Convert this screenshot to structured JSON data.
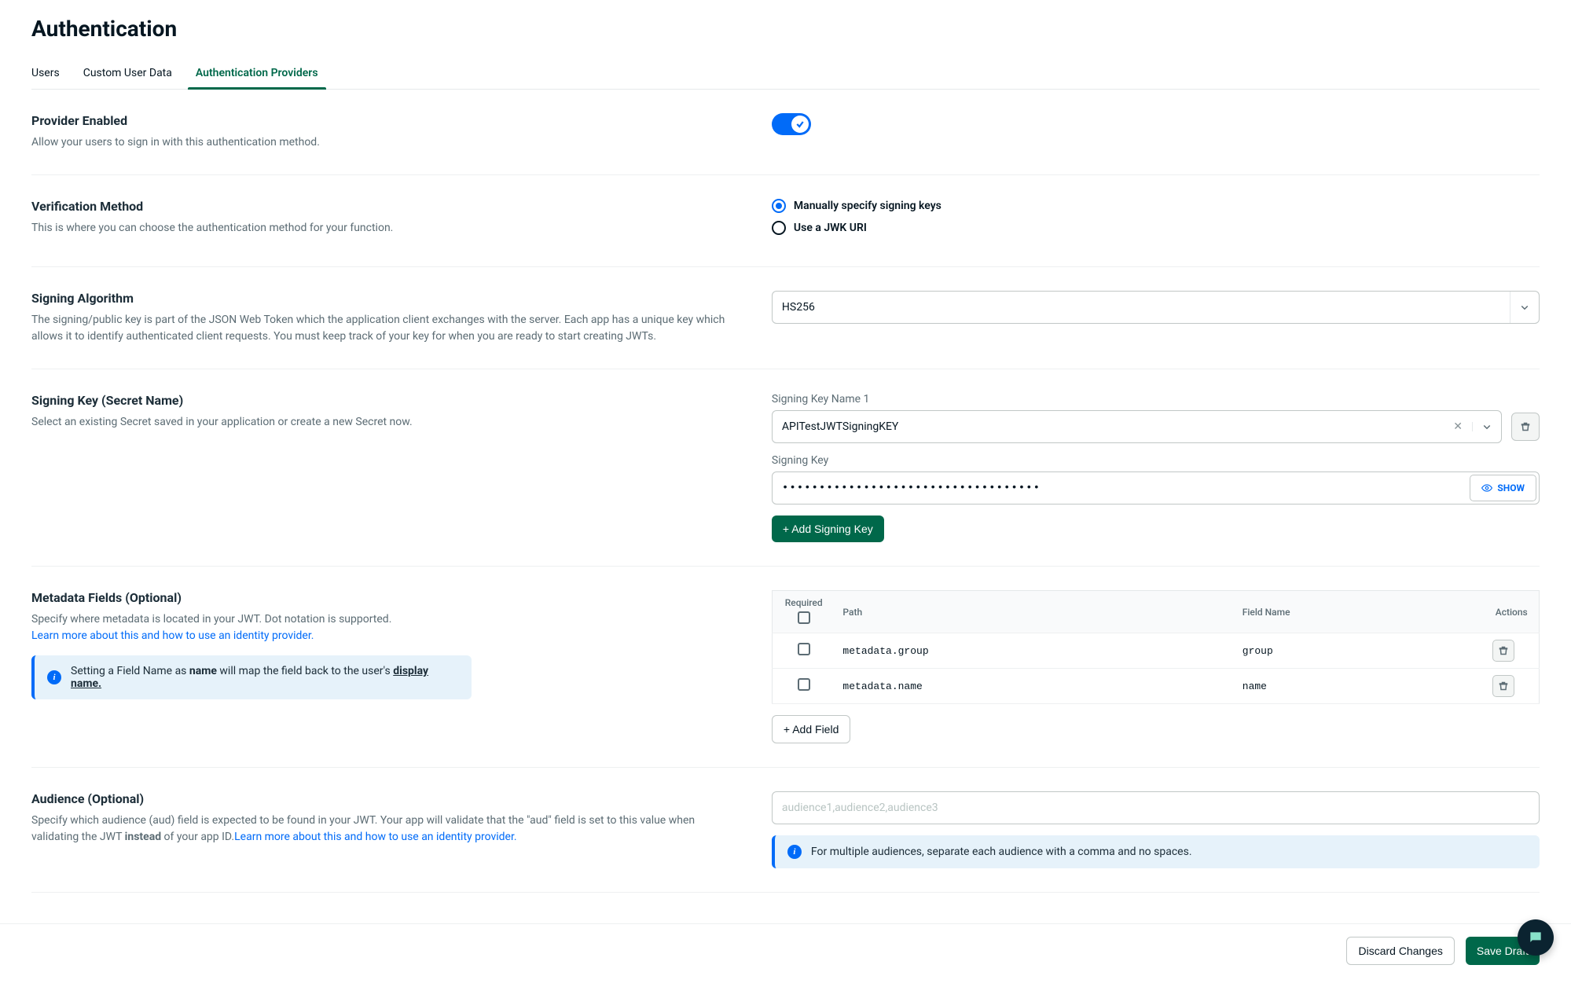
{
  "page_title": "Authentication",
  "tabs": [
    {
      "label": "Users"
    },
    {
      "label": "Custom User Data"
    },
    {
      "label": "Authentication Providers",
      "active": true
    }
  ],
  "provider_enabled": {
    "title": "Provider Enabled",
    "desc": "Allow your users to sign in with this authentication method.",
    "value": true
  },
  "verification_method": {
    "title": "Verification Method",
    "desc": "This is where you can choose the authentication method for your function.",
    "options": [
      {
        "label": "Manually specify signing keys",
        "selected": true
      },
      {
        "label": "Use a JWK URI",
        "selected": false
      }
    ]
  },
  "signing_algorithm": {
    "title": "Signing Algorithm",
    "desc": "The signing/public key is part of the JSON Web Token which the application client exchanges with the server. Each app has a unique key which allows it to identify authenticated client requests. You must keep track of your key for when you are ready to start creating JWTs.",
    "value": "HS256"
  },
  "signing_key": {
    "title": "Signing Key (Secret Name)",
    "desc": "Select an existing Secret saved in your application or create a new Secret now.",
    "name_label": "Signing Key Name 1",
    "name_value": "APITestJWTSigningKEY",
    "key_label": "Signing Key",
    "key_masked": "•••••••••••••••••••••••••••••••••••",
    "show_label": "SHOW",
    "add_label": "+ Add Signing Key"
  },
  "metadata": {
    "title": "Metadata Fields (Optional)",
    "desc": "Specify where metadata is located in your JWT. Dot notation is supported.",
    "learn_link": "Learn more about this and how to use an identity provider.",
    "banner_prefix": "Setting a Field Name as ",
    "banner_bold": "name",
    "banner_mid": " will map the field back to the user's ",
    "banner_link": "display name.",
    "headers": {
      "required": "Required",
      "path": "Path",
      "field_name": "Field Name",
      "actions": "Actions"
    },
    "rows": [
      {
        "path": "metadata.group",
        "field_name": "group"
      },
      {
        "path": "metadata.name",
        "field_name": "name"
      }
    ],
    "add_label": "+ Add Field"
  },
  "audience": {
    "title": "Audience (Optional)",
    "desc_1": "Specify which audience (aud) field is expected to be found in your JWT. Your app will validate that the \"aud\" field is set to this value when validating the JWT ",
    "desc_bold": "instead",
    "desc_2": " of your app ID.",
    "learn_link": "Learn more about this and how to use an identity provider.",
    "placeholder": "audience1,audience2,audience3",
    "banner": "For multiple audiences, separate each audience with a comma and no spaces."
  },
  "footer": {
    "discard": "Discard Changes",
    "save": "Save Draft"
  }
}
